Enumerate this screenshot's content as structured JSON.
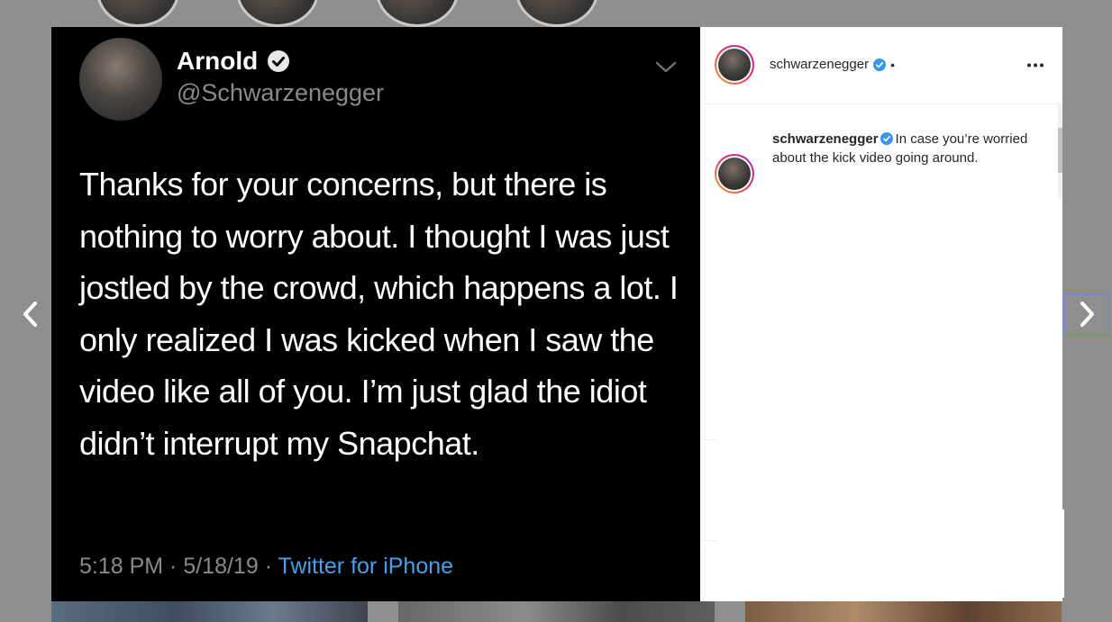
{
  "tweet": {
    "display_name": "Arnold",
    "handle": "@Schwarzenegger",
    "text": "Thanks for your concerns, but there is nothing to worry about. I thought I was just jostled by the crowd, which happens a lot. I only realized I was kicked when I saw the video like all of you. I’m just glad the idiot didn’t interrupt my Snapchat.",
    "time": "5:18 PM",
    "separator": " · ",
    "date": "5/18/19",
    "source": "Twitter for iPhone"
  },
  "panel": {
    "header_username": "schwarzenegger",
    "header_dot": "•",
    "caption_username": "schwarzenegger",
    "caption_text": "In case you’re worried about the kick video going around."
  },
  "colors": {
    "verified_blue": "#3897f0",
    "twitter_link": "#4a9fe8",
    "backdrop": "#8f8f8f"
  },
  "icons": {
    "prev": "chevron-left-icon",
    "next": "chevron-right-icon",
    "more": "more-horizontal-icon",
    "verified": "verified-badge-icon"
  }
}
